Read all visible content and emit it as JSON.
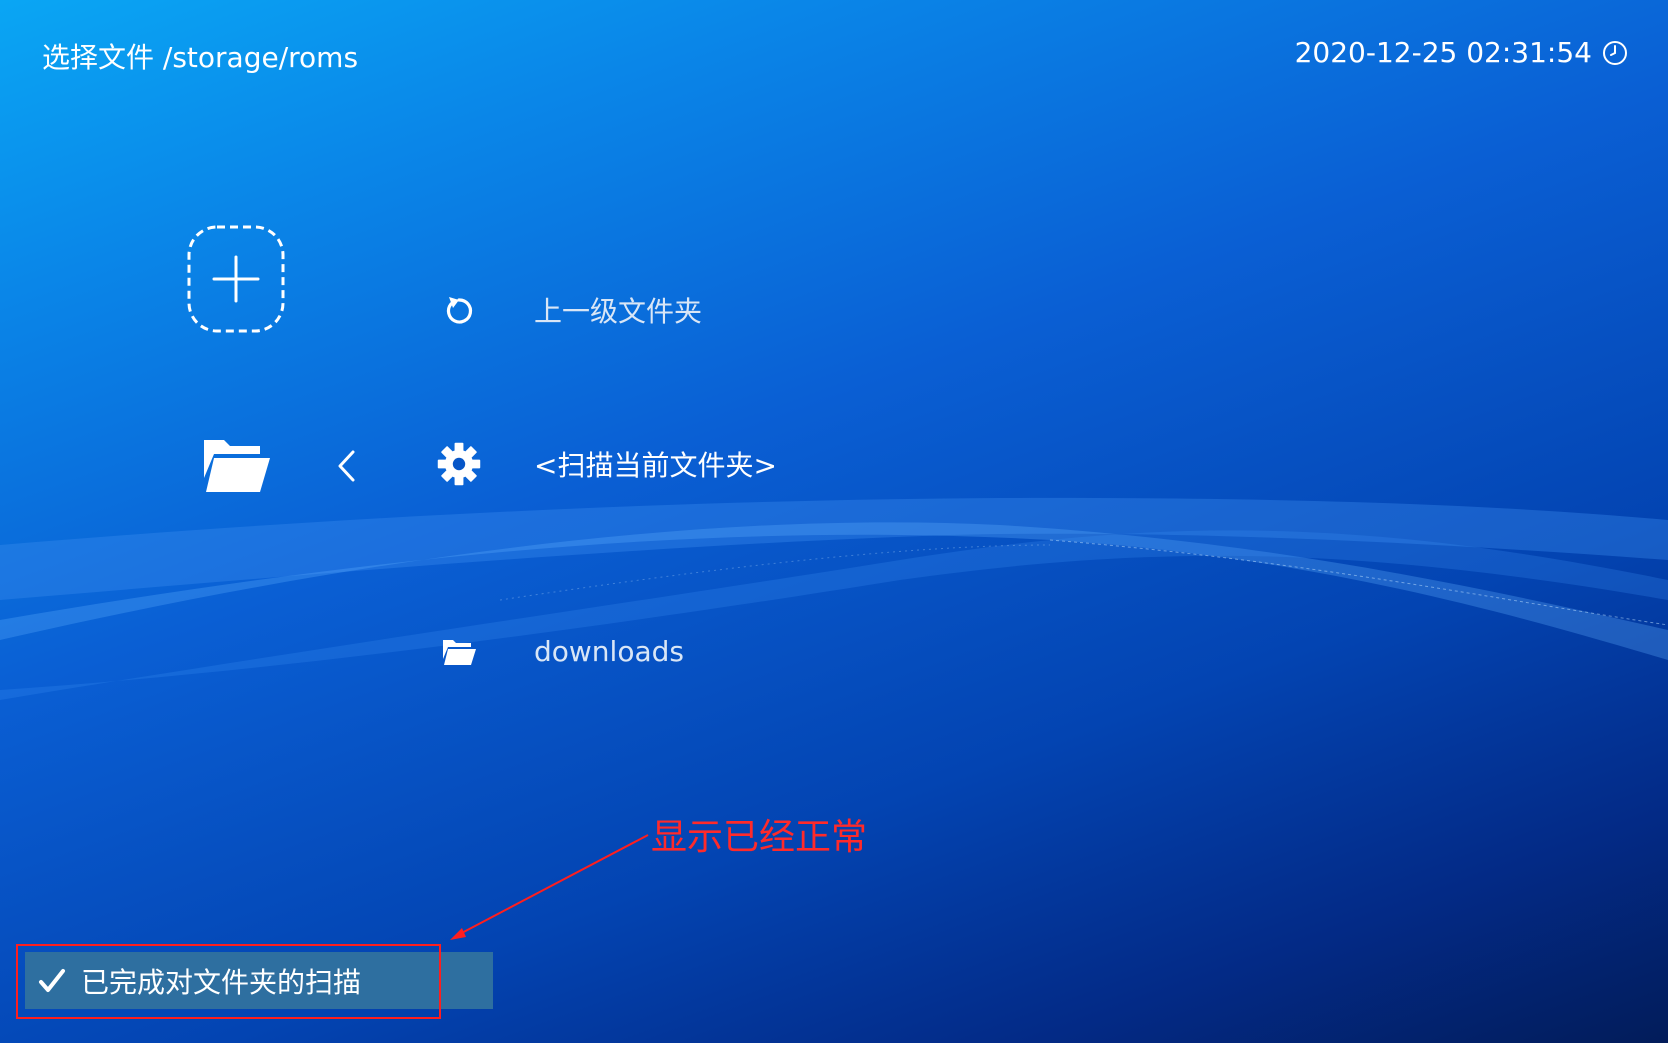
{
  "header": {
    "title": "选择文件 /storage/roms",
    "datetime": "2020-12-25 02:31:54",
    "clock_icon": "clock-icon"
  },
  "sidebar": {
    "add_icon": "add-plus-icon",
    "folder_icon": "folder-open-icon",
    "back_icon": "chevron-left-icon"
  },
  "list": {
    "items": [
      {
        "label": "上一级文件夹",
        "icon": "refresh-icon"
      },
      {
        "label": "<扫描当前文件夹>",
        "icon": "gear-icon"
      },
      {
        "label": "downloads",
        "icon": "folder-icon"
      }
    ]
  },
  "toast": {
    "label": "已完成对文件夹的扫描",
    "icon": "checkmark-icon",
    "background": "#2e6fa0"
  },
  "annotation": {
    "text": "显示已经正常",
    "color": "#ff2a2a"
  }
}
